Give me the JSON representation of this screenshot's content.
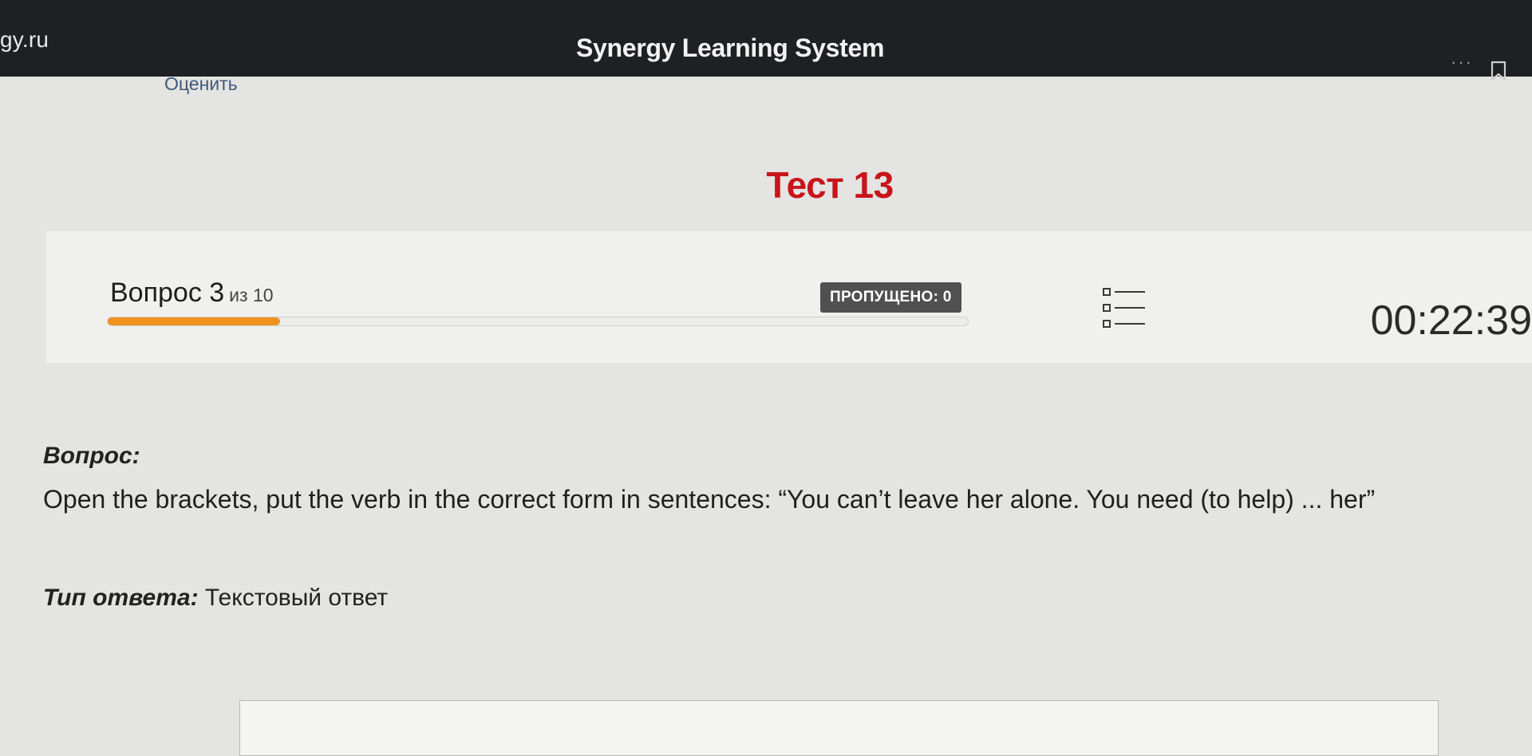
{
  "browser": {
    "url_fragment": "gy.ru",
    "tab_title": "Synergy Learning System",
    "more_icon": "more-dots-icon",
    "bookmark_icon": "bookmark-icon"
  },
  "header": {
    "rate_link": "Оценить",
    "title": "Тест 13"
  },
  "status": {
    "question_label": "Вопрос 3",
    "question_of": "из 10",
    "progress_fraction": 0.2,
    "skipped_label": "ПРОПУЩЕНО: 0",
    "timer": "00:22:39",
    "accent_color": "#f0921e"
  },
  "question": {
    "label": "Вопрос:",
    "text": "Open the brackets, put the verb in the correct form in sentences: “You can’t leave her alone. You need (to help) ... her”"
  },
  "answer": {
    "type_label": "Тип ответа:",
    "type_value": " Текстовый ответ",
    "input_value": ""
  }
}
